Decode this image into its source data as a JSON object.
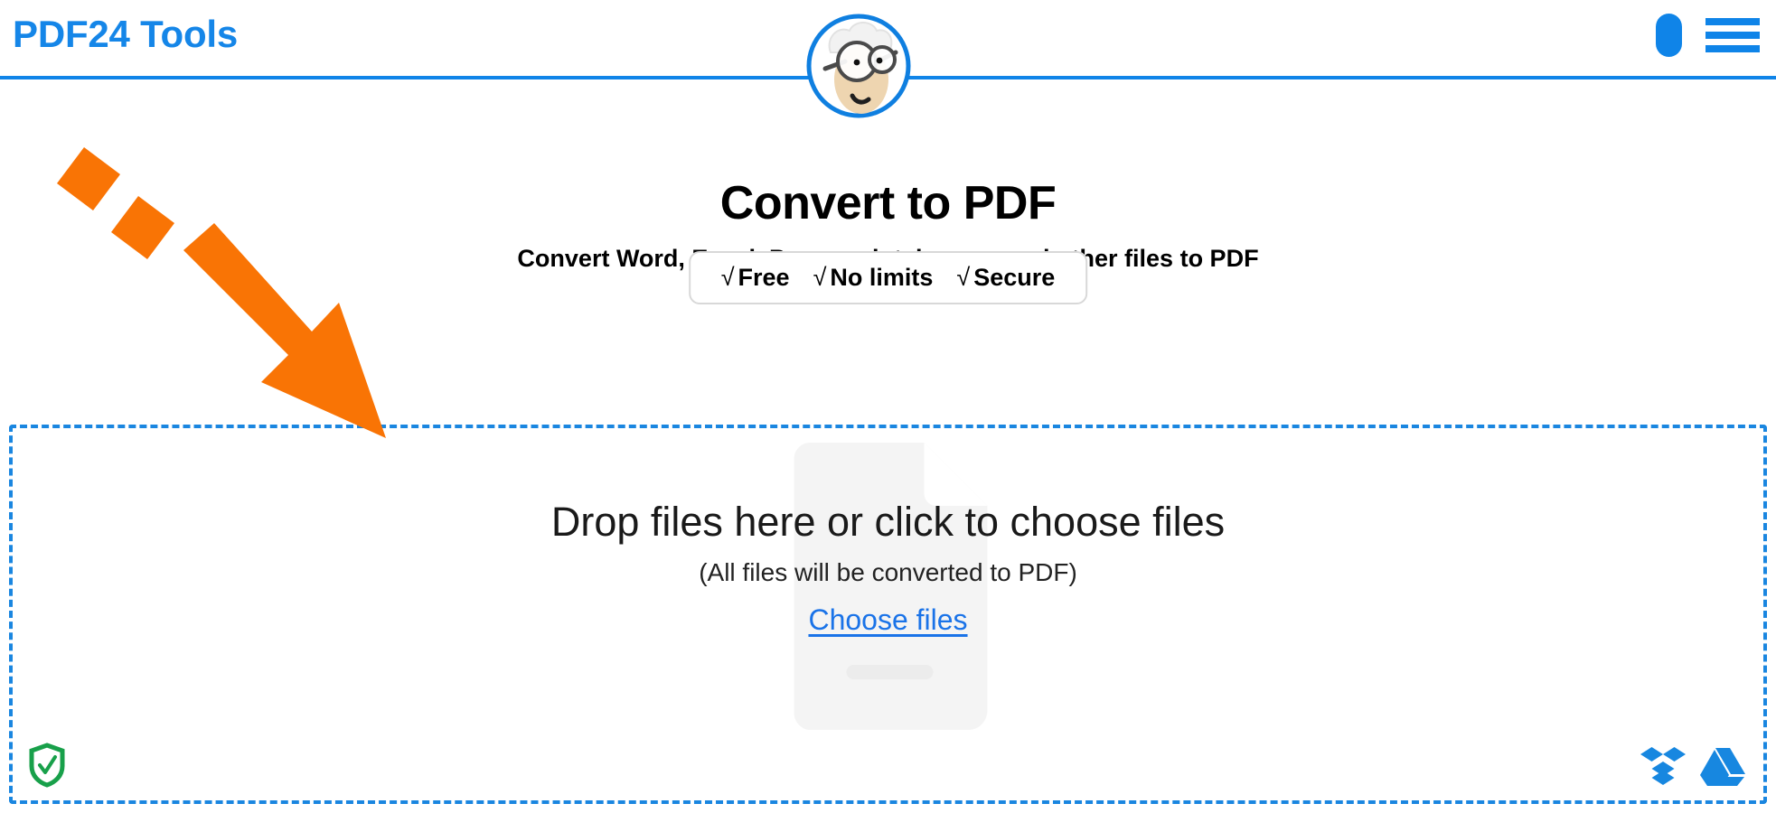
{
  "header": {
    "brand": "PDF24 Tools",
    "logo_icon": "pdf24-mascot-icon",
    "account_icon": "account-pill-icon",
    "menu_icon": "hamburger-menu-icon",
    "accent_color": "#0f84e8",
    "brand_color": "#1586e8"
  },
  "hero": {
    "title": "Convert to PDF",
    "subtitle": "Convert Word, Excel, Powerpoint, images and other files to PDF",
    "badges": [
      {
        "check": "√",
        "label": "Free"
      },
      {
        "check": "√",
        "label": "No limits"
      },
      {
        "check": "√",
        "label": "Secure"
      }
    ]
  },
  "drop_zone": {
    "watermark_icon": "file-document-icon",
    "primary_text": "Drop files here or click to choose files",
    "secondary_text": "(All files will be converted to PDF)",
    "choose_files_label": "Choose files",
    "link_color": "#1a73e8",
    "border_color": "#1a86e0",
    "privacy_icon": "shield-check-icon",
    "privacy_icon_color": "#18a04a",
    "cloud_imports": [
      {
        "icon": "dropbox-icon",
        "color": "#1787e0"
      },
      {
        "icon": "google-drive-icon",
        "color": "#1787e0"
      }
    ]
  },
  "annotation": {
    "arrow_icon": "orange-dashed-arrow-icon",
    "color": "#f97405",
    "points_to": "drop-zone"
  }
}
